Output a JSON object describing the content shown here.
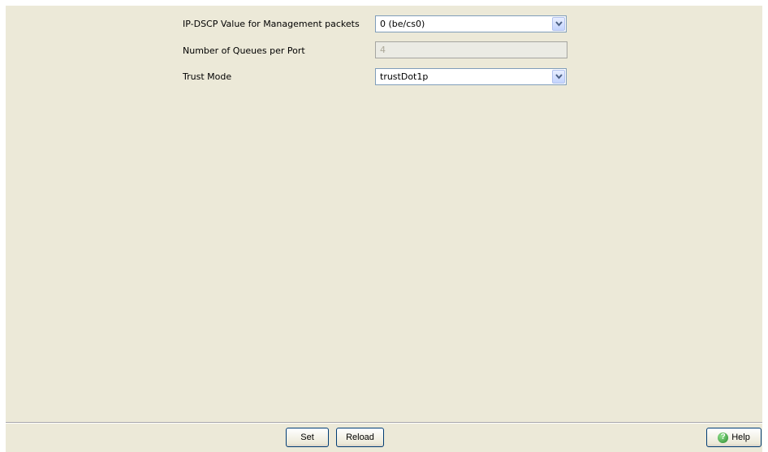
{
  "form": {
    "ipdscp": {
      "label": "IP-DSCP Value for Management packets",
      "value": "0 (be/cs0)"
    },
    "queues": {
      "label": "Number of Queues per Port",
      "value": "4"
    },
    "trust": {
      "label": "Trust Mode",
      "value": "trustDot1p"
    }
  },
  "footer": {
    "set_label": "Set",
    "reload_label": "Reload",
    "help_label": "Help"
  },
  "icons": {
    "dropdown": "chevron-down-icon",
    "help": "help-icon"
  }
}
